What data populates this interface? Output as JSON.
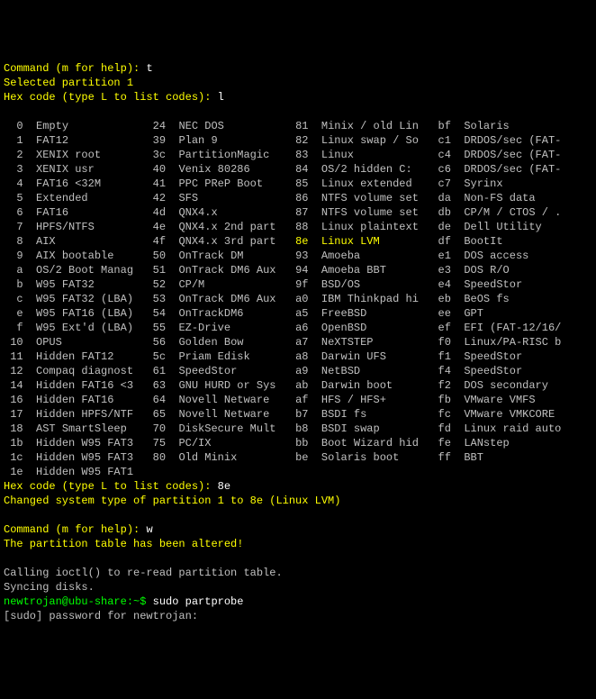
{
  "lines_before": [
    {
      "segments": [
        {
          "txt": "Command (m for help): ",
          "cls": "highlight"
        },
        {
          "txt": "t",
          "cls": "white"
        }
      ]
    },
    {
      "segments": [
        {
          "txt": "Selected partition 1",
          "cls": "highlight"
        }
      ]
    },
    {
      "segments": [
        {
          "txt": "Hex code (type L to list codes): ",
          "cls": "highlight"
        },
        {
          "txt": "l",
          "cls": "white"
        }
      ]
    },
    {
      "segments": [
        {
          "txt": "",
          "cls": ""
        }
      ]
    }
  ],
  "cols": [
    {
      "code_w": 3,
      "name_w": 17
    },
    {
      "code_w": 3,
      "name_w": 17
    },
    {
      "code_w": 3,
      "name_w": 17
    },
    {
      "code_w": 3,
      "name_w": 16
    }
  ],
  "table": [
    [
      [
        "0",
        "Empty"
      ],
      [
        "24",
        "NEC DOS"
      ],
      [
        "81",
        "Minix / old Lin"
      ],
      [
        "bf",
        "Solaris"
      ]
    ],
    [
      [
        "1",
        "FAT12"
      ],
      [
        "39",
        "Plan 9"
      ],
      [
        "82",
        "Linux swap / So"
      ],
      [
        "c1",
        "DRDOS/sec (FAT-"
      ]
    ],
    [
      [
        "2",
        "XENIX root"
      ],
      [
        "3c",
        "PartitionMagic"
      ],
      [
        "83",
        "Linux"
      ],
      [
        "c4",
        "DRDOS/sec (FAT-"
      ]
    ],
    [
      [
        "3",
        "XENIX usr"
      ],
      [
        "40",
        "Venix 80286"
      ],
      [
        "84",
        "OS/2 hidden C:"
      ],
      [
        "c6",
        "DRDOS/sec (FAT-"
      ]
    ],
    [
      [
        "4",
        "FAT16 <32M"
      ],
      [
        "41",
        "PPC PReP Boot"
      ],
      [
        "85",
        "Linux extended"
      ],
      [
        "c7",
        "Syrinx"
      ]
    ],
    [
      [
        "5",
        "Extended"
      ],
      [
        "42",
        "SFS"
      ],
      [
        "86",
        "NTFS volume set"
      ],
      [
        "da",
        "Non-FS data"
      ]
    ],
    [
      [
        "6",
        "FAT16"
      ],
      [
        "4d",
        "QNX4.x"
      ],
      [
        "87",
        "NTFS volume set"
      ],
      [
        "db",
        "CP/M / CTOS / ."
      ]
    ],
    [
      [
        "7",
        "HPFS/NTFS"
      ],
      [
        "4e",
        "QNX4.x 2nd part"
      ],
      [
        "88",
        "Linux plaintext"
      ],
      [
        "de",
        "Dell Utility"
      ]
    ],
    [
      [
        "8",
        "AIX"
      ],
      [
        "4f",
        "QNX4.x 3rd part"
      ],
      [
        "8e",
        "Linux LVM",
        true
      ],
      [
        "df",
        "BootIt"
      ]
    ],
    [
      [
        "9",
        "AIX bootable"
      ],
      [
        "50",
        "OnTrack DM"
      ],
      [
        "93",
        "Amoeba"
      ],
      [
        "e1",
        "DOS access"
      ]
    ],
    [
      [
        "a",
        "OS/2 Boot Manag"
      ],
      [
        "51",
        "OnTrack DM6 Aux"
      ],
      [
        "94",
        "Amoeba BBT"
      ],
      [
        "e3",
        "DOS R/O"
      ]
    ],
    [
      [
        "b",
        "W95 FAT32"
      ],
      [
        "52",
        "CP/M"
      ],
      [
        "9f",
        "BSD/OS"
      ],
      [
        "e4",
        "SpeedStor"
      ]
    ],
    [
      [
        "c",
        "W95 FAT32 (LBA)"
      ],
      [
        "53",
        "OnTrack DM6 Aux"
      ],
      [
        "a0",
        "IBM Thinkpad hi"
      ],
      [
        "eb",
        "BeOS fs"
      ]
    ],
    [
      [
        "e",
        "W95 FAT16 (LBA)"
      ],
      [
        "54",
        "OnTrackDM6"
      ],
      [
        "a5",
        "FreeBSD"
      ],
      [
        "ee",
        "GPT"
      ]
    ],
    [
      [
        "f",
        "W95 Ext'd (LBA)"
      ],
      [
        "55",
        "EZ-Drive"
      ],
      [
        "a6",
        "OpenBSD"
      ],
      [
        "ef",
        "EFI (FAT-12/16/"
      ]
    ],
    [
      [
        "10",
        "OPUS"
      ],
      [
        "56",
        "Golden Bow"
      ],
      [
        "a7",
        "NeXTSTEP"
      ],
      [
        "f0",
        "Linux/PA-RISC b"
      ]
    ],
    [
      [
        "11",
        "Hidden FAT12"
      ],
      [
        "5c",
        "Priam Edisk"
      ],
      [
        "a8",
        "Darwin UFS"
      ],
      [
        "f1",
        "SpeedStor"
      ]
    ],
    [
      [
        "12",
        "Compaq diagnost"
      ],
      [
        "61",
        "SpeedStor"
      ],
      [
        "a9",
        "NetBSD"
      ],
      [
        "f4",
        "SpeedStor"
      ]
    ],
    [
      [
        "14",
        "Hidden FAT16 <3"
      ],
      [
        "63",
        "GNU HURD or Sys"
      ],
      [
        "ab",
        "Darwin boot"
      ],
      [
        "f2",
        "DOS secondary"
      ]
    ],
    [
      [
        "16",
        "Hidden FAT16"
      ],
      [
        "64",
        "Novell Netware"
      ],
      [
        "af",
        "HFS / HFS+"
      ],
      [
        "fb",
        "VMware VMFS"
      ]
    ],
    [
      [
        "17",
        "Hidden HPFS/NTF"
      ],
      [
        "65",
        "Novell Netware"
      ],
      [
        "b7",
        "BSDI fs"
      ],
      [
        "fc",
        "VMware VMKCORE"
      ]
    ],
    [
      [
        "18",
        "AST SmartSleep"
      ],
      [
        "70",
        "DiskSecure Mult"
      ],
      [
        "b8",
        "BSDI swap"
      ],
      [
        "fd",
        "Linux raid auto"
      ]
    ],
    [
      [
        "1b",
        "Hidden W95 FAT3"
      ],
      [
        "75",
        "PC/IX"
      ],
      [
        "bb",
        "Boot Wizard hid"
      ],
      [
        "fe",
        "LANstep"
      ]
    ],
    [
      [
        "1c",
        "Hidden W95 FAT3"
      ],
      [
        "80",
        "Old Minix"
      ],
      [
        "be",
        "Solaris boot"
      ],
      [
        "ff",
        "BBT"
      ]
    ],
    [
      [
        "1e",
        "Hidden W95 FAT1"
      ]
    ]
  ],
  "lines_after": [
    {
      "segments": [
        {
          "txt": "Hex code (type L to list codes): ",
          "cls": "highlight"
        },
        {
          "txt": "8e",
          "cls": "white"
        }
      ]
    },
    {
      "segments": [
        {
          "txt": "Changed system type of partition 1 to 8e (Linux LVM)",
          "cls": "highlight"
        }
      ]
    },
    {
      "segments": [
        {
          "txt": "",
          "cls": ""
        }
      ]
    },
    {
      "segments": [
        {
          "txt": "Command (m for help): ",
          "cls": "highlight"
        },
        {
          "txt": "w",
          "cls": "white"
        }
      ]
    },
    {
      "segments": [
        {
          "txt": "The partition table has been altered!",
          "cls": "highlight"
        }
      ]
    },
    {
      "segments": [
        {
          "txt": "",
          "cls": ""
        }
      ]
    },
    {
      "segments": [
        {
          "txt": "Calling ioctl() to re-read partition table.",
          "cls": ""
        }
      ]
    },
    {
      "segments": [
        {
          "txt": "Syncing disks.",
          "cls": ""
        }
      ]
    },
    {
      "segments": [
        {
          "txt": "newtrojan@ubu-share:~$ ",
          "cls": "green"
        },
        {
          "txt": "sudo partprobe",
          "cls": "white"
        }
      ]
    },
    {
      "segments": [
        {
          "txt": "[sudo] password for newtrojan:",
          "cls": ""
        }
      ]
    }
  ]
}
